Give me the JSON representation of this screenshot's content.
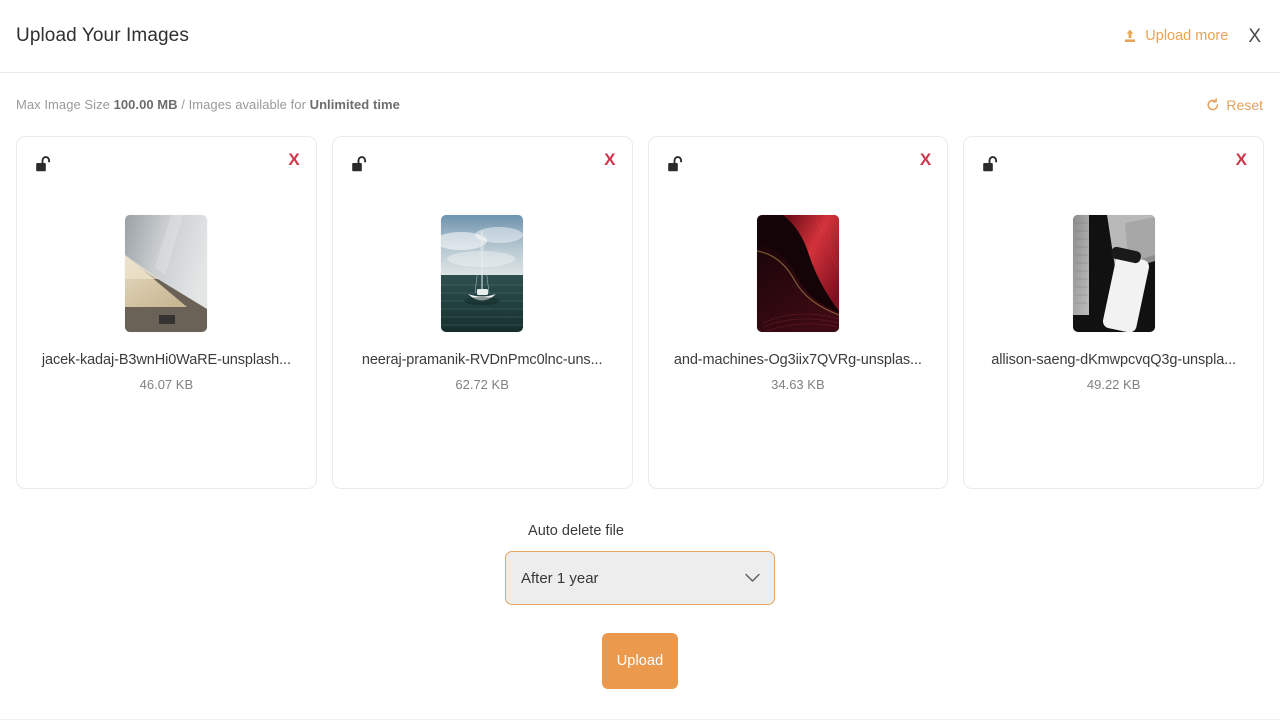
{
  "header": {
    "title": "Upload Your Images",
    "upload_more_label": "Upload more",
    "upload_more_icon": "upload-icon",
    "close_label": "X",
    "close_icon": "close-icon",
    "accent_color": "#e9a356"
  },
  "infobar": {
    "prefix": "Max Image Size ",
    "max_size": "100.00 MB",
    "middle": " / Images available for ",
    "duration": "Unlimited time",
    "reset_label": "Reset",
    "reset_icon": "refresh-icon",
    "reset_color": "#e2a15c"
  },
  "cards": [
    {
      "lock_icon": "unlock-icon",
      "remove_label": "X",
      "remove_icon": "close-icon",
      "filename": "jacek-kadaj-B3wnHi0WaRE-unsplash...",
      "filesize": "46.07 KB",
      "thumb_name": "beige-wooden-surface-thumbnail"
    },
    {
      "lock_icon": "unlock-icon",
      "remove_label": "X",
      "remove_icon": "close-icon",
      "filename": "neeraj-pramanik-RVDnPmc0lnc-uns...",
      "filesize": "62.72 KB",
      "thumb_name": "sailboat-on-ocean-thumbnail"
    },
    {
      "lock_icon": "unlock-icon",
      "remove_label": "X",
      "remove_icon": "close-icon",
      "filename": "and-machines-Og3iix7QVRg-unsplas...",
      "filesize": "34.63 KB",
      "thumb_name": "dark-red-abstract-waves-thumbnail"
    },
    {
      "lock_icon": "unlock-icon",
      "remove_label": "X",
      "remove_icon": "close-icon",
      "filename": "allison-saeng-dKmwpcvqQ3g-unspla...",
      "filesize": "49.22 KB",
      "thumb_name": "grayscale-phone-shapes-thumbnail"
    }
  ],
  "controls": {
    "auto_delete_label": "Auto delete file",
    "auto_delete_value": "After 1 year",
    "chevron_icon": "chevron-down-icon",
    "upload_button_label": "Upload",
    "upload_button_color": "#eb9a4d",
    "select_border_color": "#e2a662",
    "select_background": "#ededed"
  }
}
